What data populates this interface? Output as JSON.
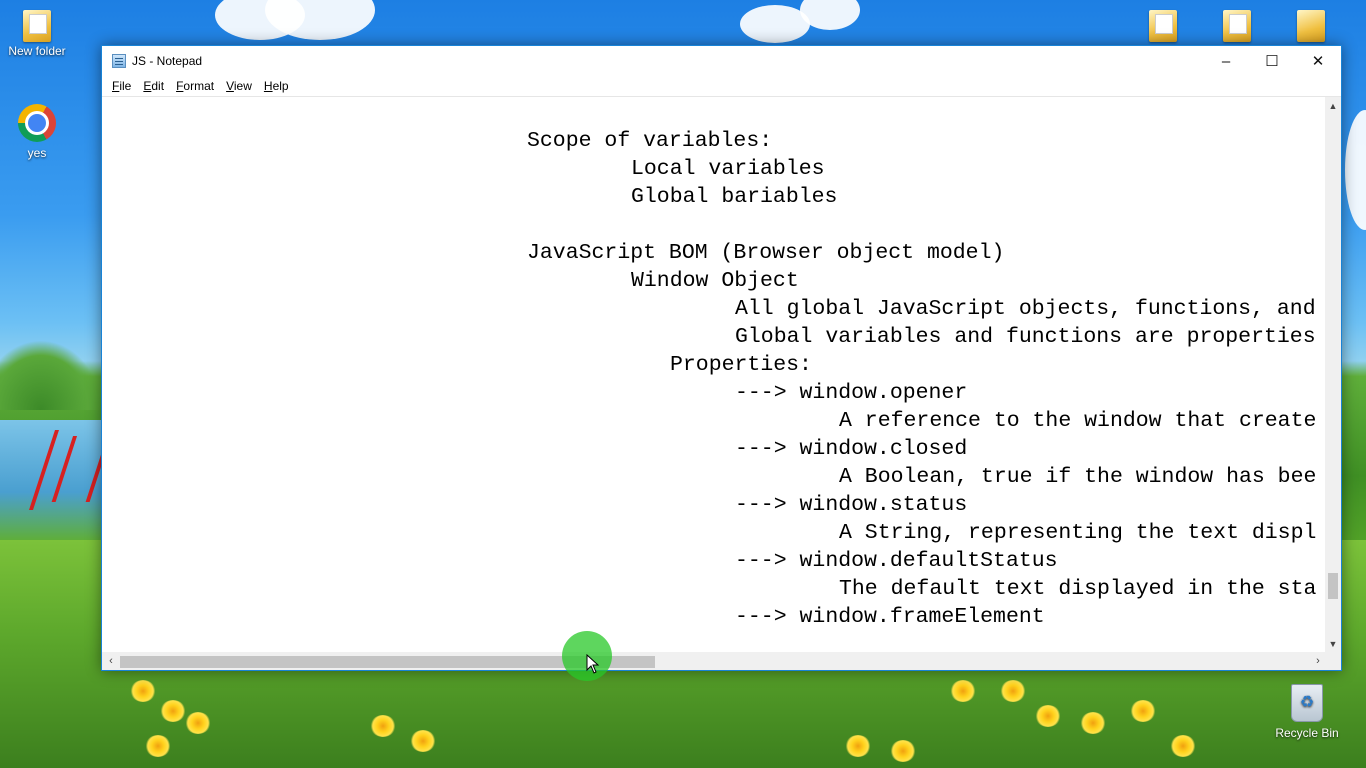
{
  "desktop": {
    "icons": [
      {
        "label": "New folder",
        "icon": "folder-icon"
      },
      {
        "label": "yes",
        "icon": "chrome-icon"
      },
      {
        "label": "Recycle Bin",
        "icon": "recycle-bin-icon"
      }
    ]
  },
  "window": {
    "title": "JS - Notepad",
    "controls": {
      "minimize": "–",
      "maximize": "☐",
      "close": "✕"
    },
    "menu": [
      {
        "key": "F",
        "rest": "ile"
      },
      {
        "key": "E",
        "rest": "dit"
      },
      {
        "key": "F",
        "rest": "ormat"
      },
      {
        "key": "V",
        "rest": "iew"
      },
      {
        "key": "H",
        "rest": "elp"
      }
    ]
  },
  "document": {
    "lines": [
      "Scope of variables:",
      "Local variables",
      "Global bariables",
      "JavaScript BOM (Browser object model)",
      "Window Object",
      "All global JavaScript objects, functions, and",
      "Global variables and functions are properties",
      "Properties:",
      "---> window.opener",
      "A reference to the window that create",
      "---> window.closed",
      "A Boolean, true if the window has bee",
      "---> window.status",
      "A String, representing the text displ",
      "---> window.defaultStatus",
      "The default text displayed in the sta",
      "---> window.frameElement"
    ]
  },
  "scrollbars": {
    "horizontal_position": 0.0,
    "horizontal_visible_fraction": 0.45,
    "vertical_position": 0.92
  },
  "colors": {
    "window_border": "#1883d7",
    "cursor_highlight": "#28c828"
  }
}
